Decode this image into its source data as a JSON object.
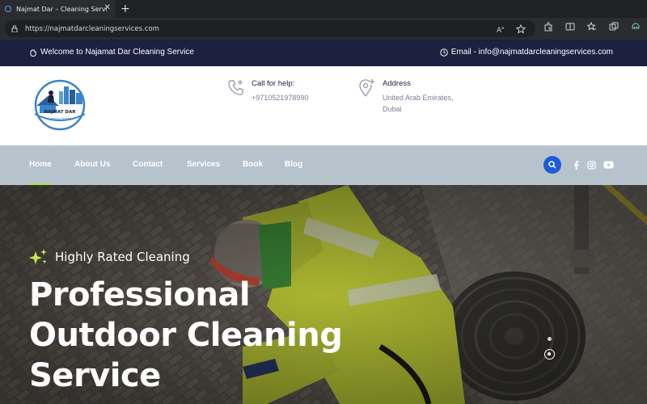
{
  "browser": {
    "tab_title": "Najmat Dar – Cleaning Service",
    "tab_close": "✕",
    "new_tab": "+",
    "url": "https://najmatdarcleaningservices.com"
  },
  "infobar": {
    "welcome": "Welcome to Najamat Dar Cleaning Service",
    "email": "Email - info@najmatdarcleaningservices.com"
  },
  "header": {
    "logo_text": "NAJMAT DAR",
    "logo_subtext": "Cleaning Service",
    "call": {
      "title": "Call for help:",
      "value": "+9710521978990"
    },
    "address": {
      "title": "Address",
      "line1": "United Arab Emirates,",
      "line2": "Dubai"
    }
  },
  "nav": {
    "items": [
      {
        "label": "Home"
      },
      {
        "label": "About Us"
      },
      {
        "label": "Contact"
      },
      {
        "label": "Services"
      },
      {
        "label": "Book"
      },
      {
        "label": "Blog"
      }
    ],
    "active_index": 0
  },
  "hero": {
    "tagline": "Highly Rated Cleaning",
    "title_lines": [
      "Professional",
      "Outdoor Cleaning",
      "Service"
    ]
  },
  "colors": {
    "infobar_bg": "#1c2140",
    "nav_bg": "#b6c3cd",
    "accent_green": "#a8e04a",
    "search_blue": "#1e5bd8"
  }
}
